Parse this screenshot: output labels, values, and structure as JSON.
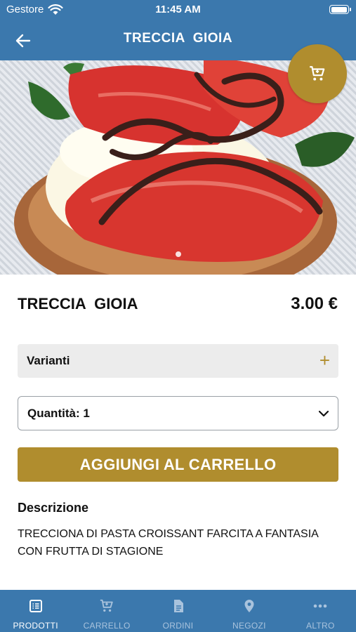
{
  "status_bar": {
    "carrier": "Gestore",
    "time": "11:45 AM"
  },
  "header": {
    "title": "TRECCIA  GIOIA"
  },
  "product": {
    "name": "TRECCIA  GIOIA",
    "price": "3.00 €",
    "variants_label": "Varianti",
    "variants_toggle": "+",
    "quantity_label": "Quantità: 1",
    "add_to_cart_label": "AGGIUNGI AL CARRELLO",
    "description_title": "Descrizione",
    "description_text": "TRECCIONA DI PASTA CROISSANT FARCITA A FANTASIA CON FRUTTA DI STAGIONE"
  },
  "colors": {
    "brand_blue": "#3b78ad",
    "accent_gold": "#b08d2e"
  },
  "tabs": [
    {
      "label": "PRODOTTI",
      "icon": "list-icon",
      "active": true
    },
    {
      "label": "CARRELLO",
      "icon": "cart-icon",
      "active": false
    },
    {
      "label": "ORDINI",
      "icon": "document-icon",
      "active": false
    },
    {
      "label": "NEGOZI",
      "icon": "location-pin-icon",
      "active": false
    },
    {
      "label": "ALTRO",
      "icon": "more-dots-icon",
      "active": false
    }
  ]
}
